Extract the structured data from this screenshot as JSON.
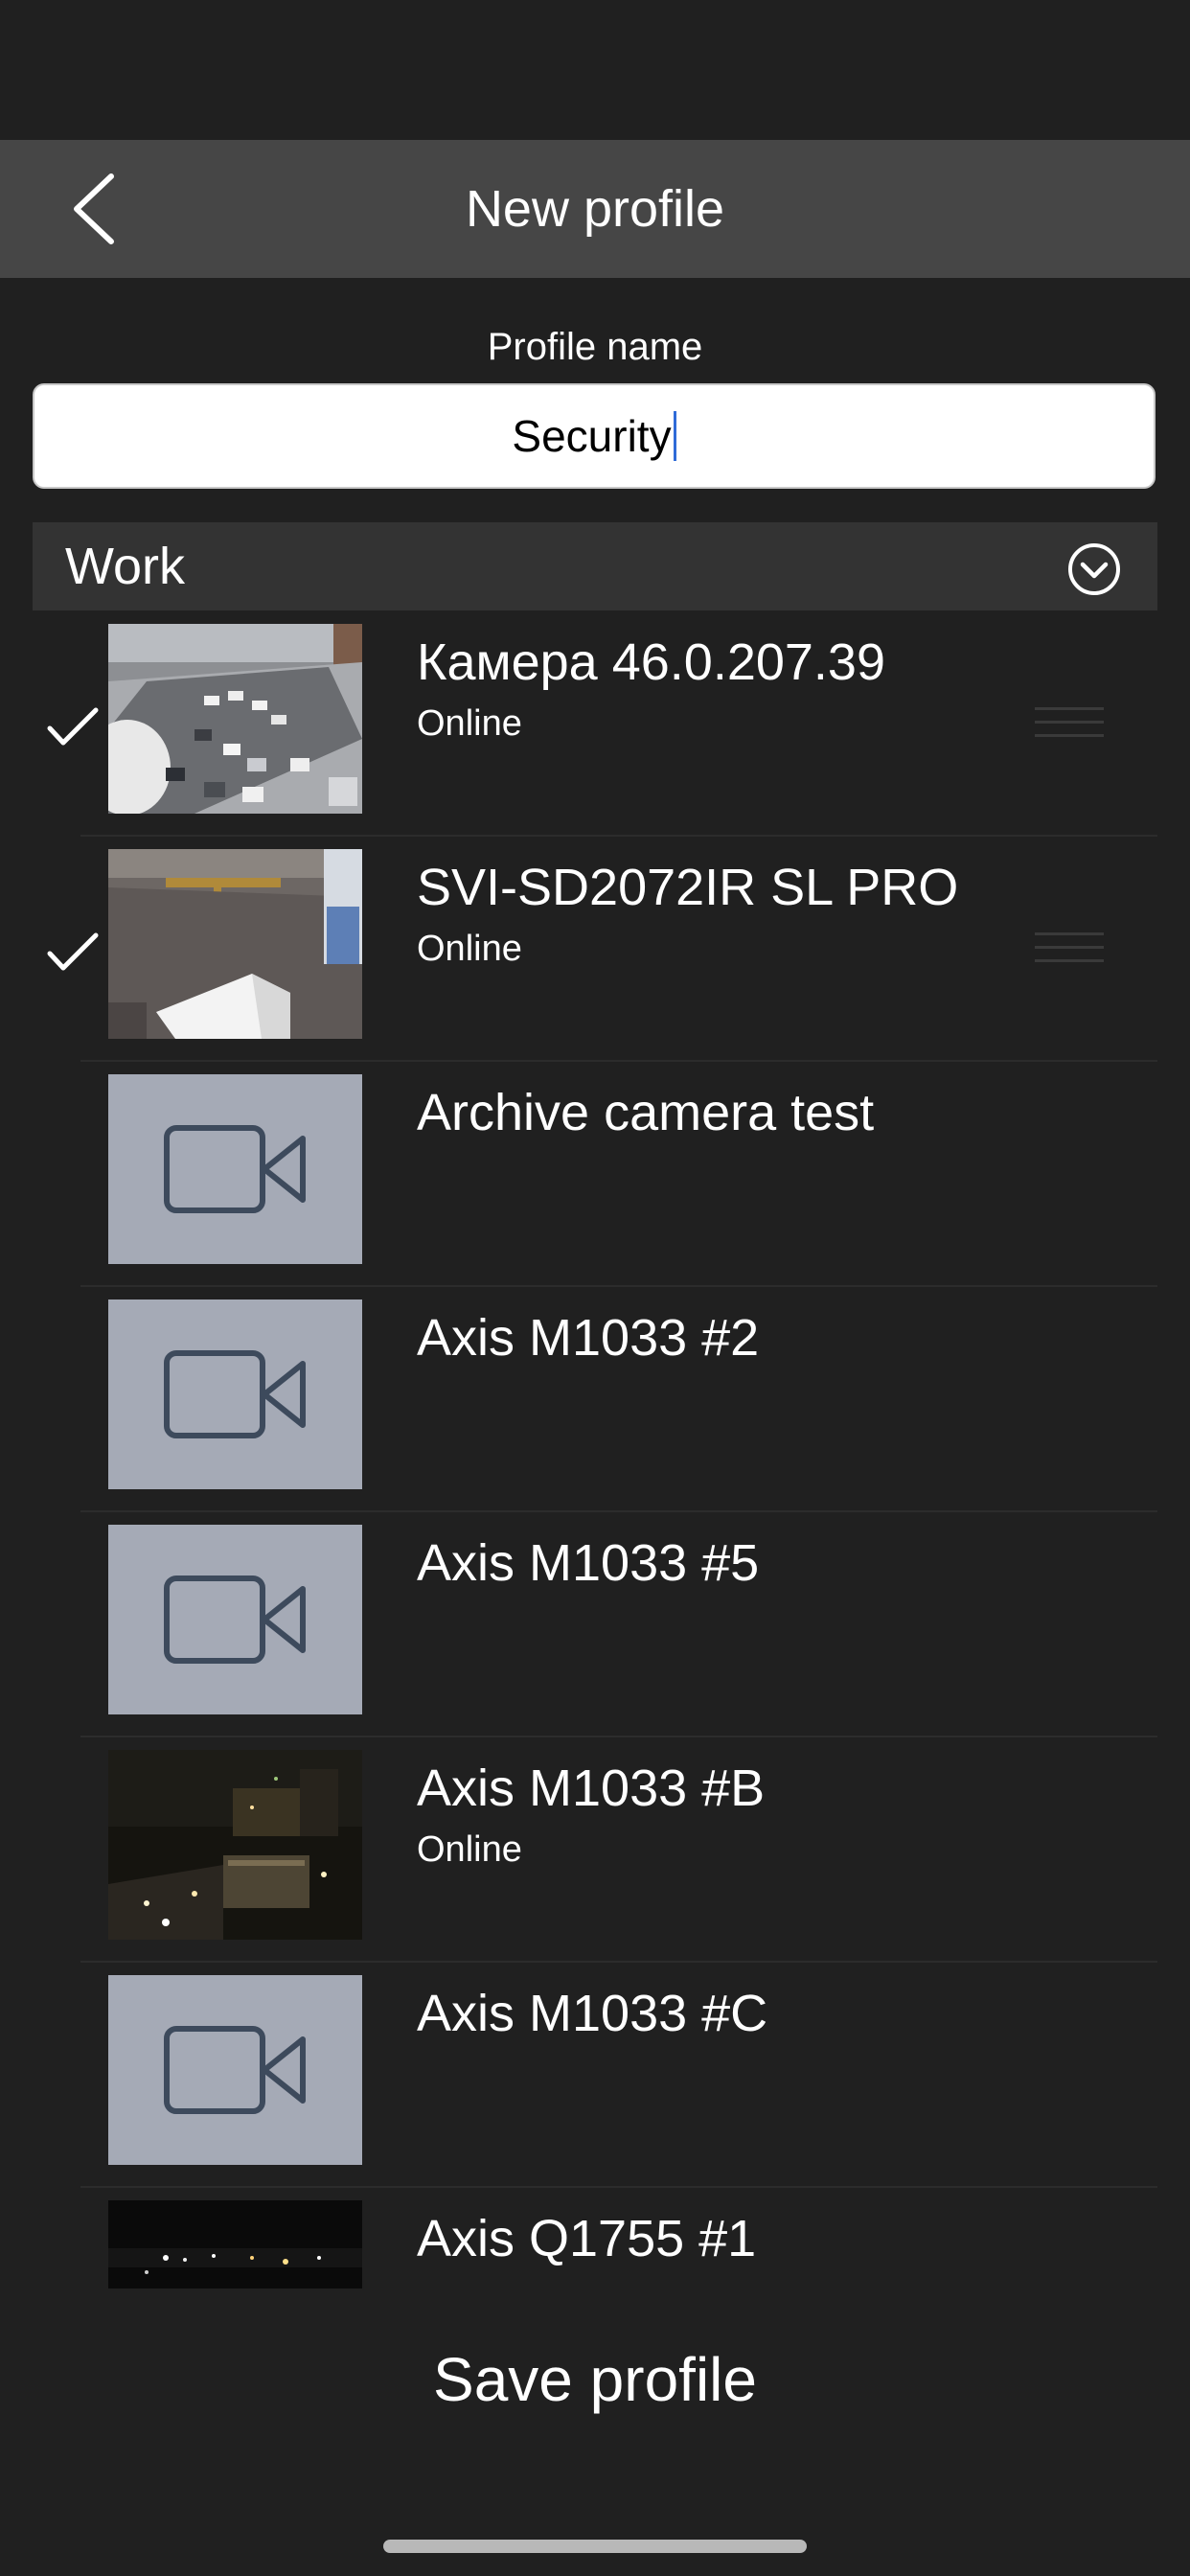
{
  "header": {
    "title": "New profile"
  },
  "profile": {
    "label": "Profile name",
    "value": "Security"
  },
  "group": {
    "title": "Work"
  },
  "cameras": [
    {
      "name": "Камера 46.0.207.39",
      "status": "Online",
      "selected": true,
      "thumbnail": "snow-street"
    },
    {
      "name": "SVI-SD2072IR SL PRO",
      "status": "Online",
      "selected": true,
      "thumbnail": "yard-truck"
    },
    {
      "name": "Archive camera test",
      "status": "",
      "selected": false,
      "thumbnail": "placeholder"
    },
    {
      "name": "Axis M1033 #2",
      "status": "",
      "selected": false,
      "thumbnail": "placeholder"
    },
    {
      "name": "Axis M1033 #5",
      "status": "",
      "selected": false,
      "thumbnail": "placeholder"
    },
    {
      "name": "Axis M1033 #B",
      "status": "Online",
      "selected": false,
      "thumbnail": "night-city"
    },
    {
      "name": "Axis M1033 #C",
      "status": "",
      "selected": false,
      "thumbnail": "placeholder"
    },
    {
      "name": "Axis Q1755 #1",
      "status": "",
      "selected": false,
      "thumbnail": "night-lights"
    }
  ],
  "footer": {
    "save_label": "Save profile"
  },
  "colors": {
    "background": "#202020",
    "nav_bar": "#464646",
    "group_header": "#333333",
    "placeholder": "#a5aab6",
    "placeholder_icon": "#3d4a5c"
  }
}
